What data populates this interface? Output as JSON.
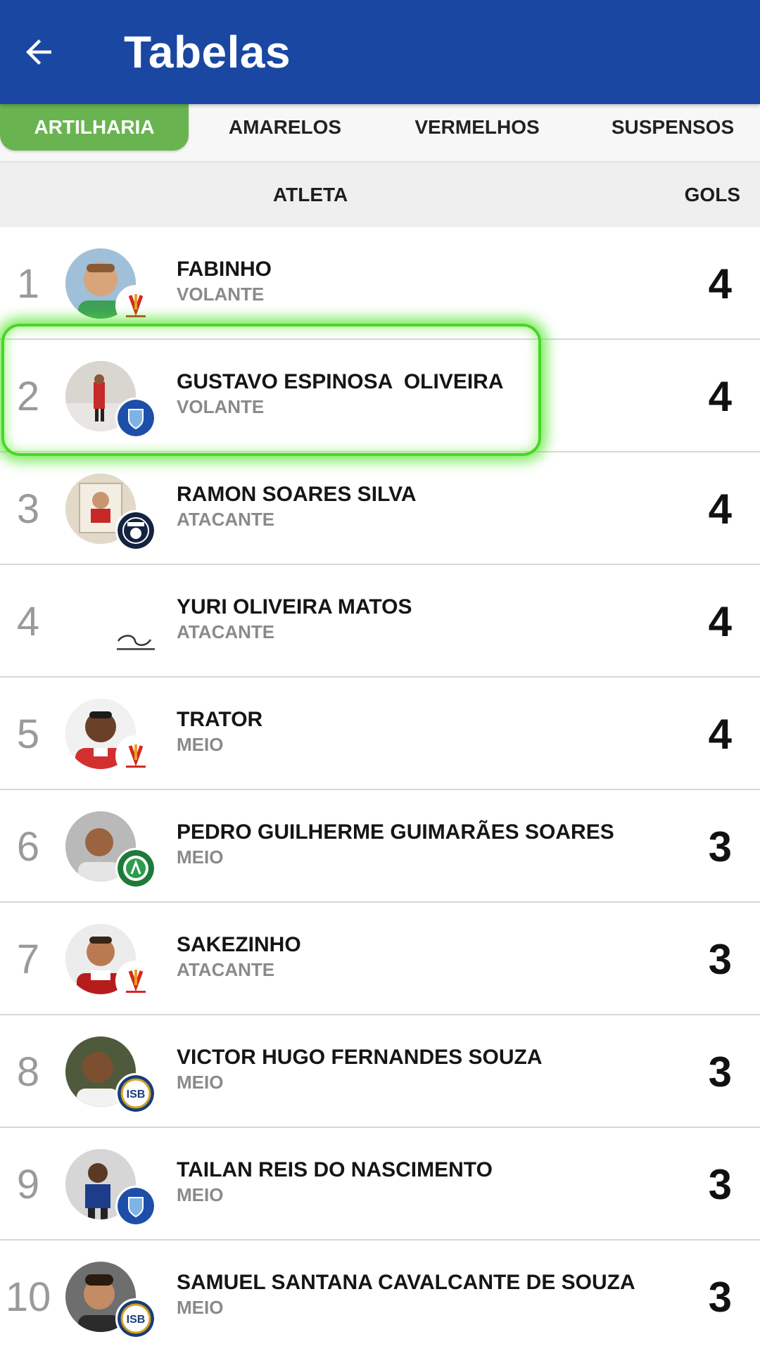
{
  "app_bar": {
    "title": "Tabelas",
    "back_icon": "arrow-left-icon",
    "background_color": "#1a47a2"
  },
  "tabs": [
    {
      "label": "ARTILHARIA",
      "active": true
    },
    {
      "label": "AMARELOS",
      "active": false
    },
    {
      "label": "VERMELHOS",
      "active": false
    },
    {
      "label": "SUSPENSOS",
      "active": false
    }
  ],
  "accent_color": "#69b450",
  "highlight_color": "#47d627",
  "table": {
    "headers": {
      "atleta": "ATLETA",
      "gols": "GOLS"
    },
    "rows": [
      {
        "rank": "1",
        "name": "FABINHO",
        "position": "VOLANTE",
        "gols": "4",
        "avatar": "player-photo",
        "team_badge": "red-team-badge"
      },
      {
        "rank": "2",
        "name": "GUSTAVO ESPINOSA  OLIVEIRA",
        "position": "VOLANTE",
        "gols": "4",
        "avatar": "player-photo",
        "team_badge": "blue-shield-badge",
        "highlighted": true
      },
      {
        "rank": "3",
        "name": "RAMON SOARES SILVA",
        "position": "ATACANTE",
        "gols": "4",
        "avatar": "player-photo",
        "team_badge": "navy-round-badge"
      },
      {
        "rank": "4",
        "name": "YURI OLIVEIRA MATOS",
        "position": "ATACANTE",
        "gols": "4",
        "avatar": "none",
        "team_badge": "small-logo-badge"
      },
      {
        "rank": "5",
        "name": "TRATOR",
        "position": "MEIO",
        "gols": "4",
        "avatar": "player-photo",
        "team_badge": "red-team-badge"
      },
      {
        "rank": "6",
        "name": "PEDRO GUILHERME GUIMARÃES SOARES",
        "position": "MEIO",
        "gols": "3",
        "avatar": "player-photo",
        "team_badge": "green-round-badge"
      },
      {
        "rank": "7",
        "name": "SAKEZINHO",
        "position": "ATACANTE",
        "gols": "3",
        "avatar": "player-photo",
        "team_badge": "red-team-badge"
      },
      {
        "rank": "8",
        "name": "VICTOR HUGO FERNANDES SOUZA",
        "position": "MEIO",
        "gols": "3",
        "avatar": "player-photo",
        "team_badge": "isb-badge"
      },
      {
        "rank": "9",
        "name": "TAILAN REIS DO NASCIMENTO",
        "position": "MEIO",
        "gols": "3",
        "avatar": "player-photo",
        "team_badge": "blue-shield-badge"
      },
      {
        "rank": "10",
        "name": "SAMUEL SANTANA CAVALCANTE DE SOUZA",
        "position": "MEIO",
        "gols": "3",
        "avatar": "player-photo",
        "team_badge": "isb-badge"
      }
    ]
  }
}
